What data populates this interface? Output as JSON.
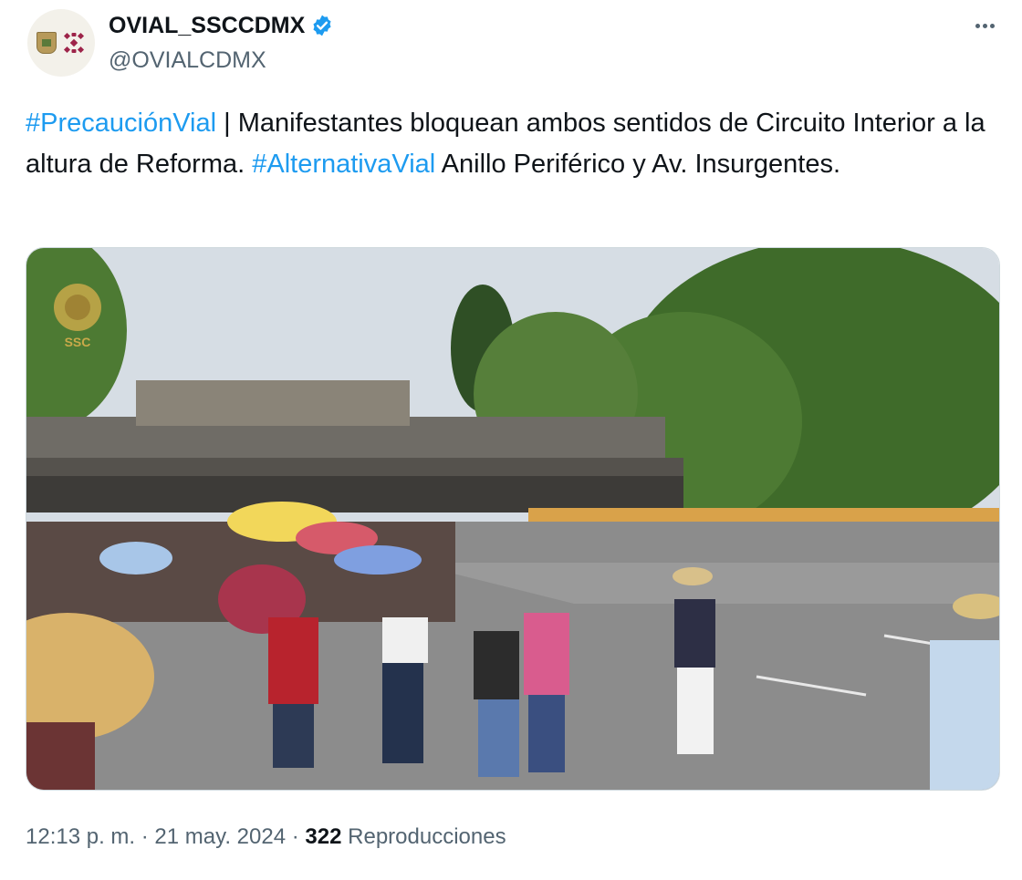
{
  "header": {
    "display_name": "OVIAL_SSCCDMX",
    "handle": "@OVIALCDMX",
    "verified_icon": "verified-badge-icon",
    "more_icon": "more-options-icon",
    "avatar_icon": "ssc-cdmx-logo"
  },
  "tweet": {
    "hashtag_1": "#PrecauciónVial",
    "text_1": " | Manifestantes bloquean ambos sentidos de Circuito Interior  a la altura de Reforma. ",
    "hashtag_2": "#AlternativaVial",
    "text_2": " Anillo Periférico y Av. Insurgentes."
  },
  "media": {
    "type": "photo",
    "watermark_text": "SSC",
    "alt_icon": "protest-photo"
  },
  "footer": {
    "time": "12:13 p. m.",
    "separator": "·",
    "date": "21 may. 2024",
    "views_count": "322",
    "views_label": "Reproducciones"
  },
  "colors": {
    "link": "#1d9bf0",
    "text": "#0f1419",
    "secondary": "#536471",
    "verified": "#1d9bf0"
  }
}
